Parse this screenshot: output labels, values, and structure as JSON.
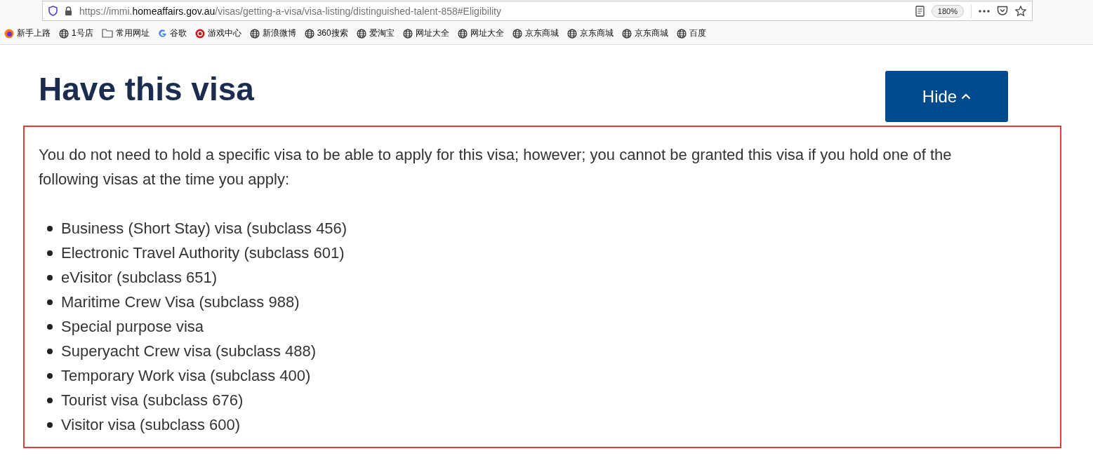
{
  "address_bar": {
    "url_prefix": "https://immi.",
    "url_domain": "homeaffairs.gov.au",
    "url_path": "/visas/getting-a-visa/visa-listing/distinguished-talent-858#Eligibility",
    "zoom": "180%"
  },
  "bookmarks": [
    {
      "label": "新手上路",
      "kind": "firefox"
    },
    {
      "label": "1号店",
      "kind": "globe"
    },
    {
      "label": "常用网址",
      "kind": "folder"
    },
    {
      "label": "谷歌",
      "kind": "google"
    },
    {
      "label": "游戏中心",
      "kind": "game"
    },
    {
      "label": "新浪微博",
      "kind": "globe"
    },
    {
      "label": "360搜索",
      "kind": "globe"
    },
    {
      "label": "爱淘宝",
      "kind": "globe"
    },
    {
      "label": "网址大全",
      "kind": "globe"
    },
    {
      "label": "网址大全",
      "kind": "globe"
    },
    {
      "label": "京东商城",
      "kind": "globe"
    },
    {
      "label": "京东商城",
      "kind": "globe"
    },
    {
      "label": "京东商城",
      "kind": "globe"
    },
    {
      "label": "百度",
      "kind": "globe"
    }
  ],
  "section": {
    "title": "Have this visa",
    "toggle_button": "Hide",
    "expanded": true,
    "intro": "You do not need to hold a specific visa to be able to apply for this visa; however; you cannot be granted this visa if you hold one of the following visas at the time you apply:",
    "visas": [
      "Business (Short Stay) visa (subclass 456)",
      "Electronic Travel Authority (subclass 601)",
      "eVisitor (subclass 651)",
      "Maritime Crew Visa (subclass 988)",
      "Special purpose visa",
      "Superyacht Crew visa (subclass 488)",
      "Temporary Work visa (subclass 400)",
      "Tourist visa (subclass 676)",
      "Visitor visa (subclass 600)"
    ]
  }
}
